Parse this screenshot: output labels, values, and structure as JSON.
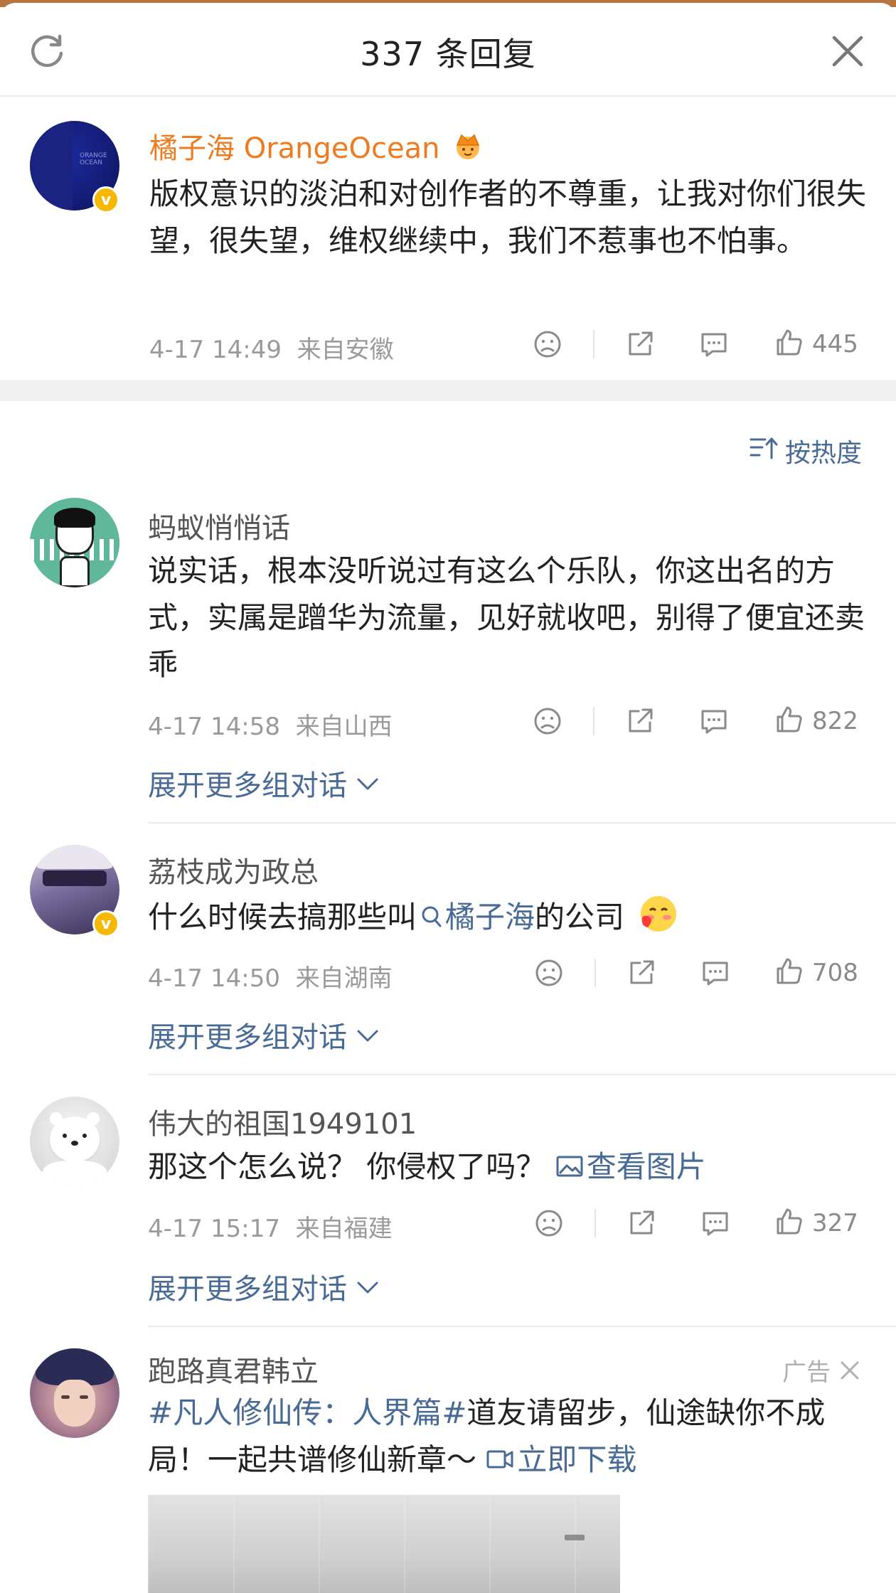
{
  "header": {
    "title": "337 条回复"
  },
  "main_comment": {
    "author": "橘子海 OrangeOcean",
    "avatar_text": "ORANGE OCEAN",
    "text": "版权意识的淡泊和对创作者的不尊重，让我对你们很失望，很失望，维权继续中，我们不惹事也不怕事。",
    "time": "4-17 14:49",
    "location": "来自安徽",
    "likes": "445"
  },
  "sort": {
    "label": "按热度"
  },
  "replies": [
    {
      "author": "蚂蚁悄悄话",
      "text": "说实话，根本没听说过有这么个乐队，你这出名的方式，实属是蹭华为流量，见好就收吧，别得了便宜还卖乖",
      "time": "4-17 14:58",
      "location": "来自山西",
      "likes": "822",
      "expand": "展开更多组对话"
    },
    {
      "author": "荔枝成为政总",
      "text_before": "什么时候去搞那些叫",
      "link": "橘子海",
      "text_after": "的公司",
      "time": "4-17 14:50",
      "location": "来自湖南",
      "likes": "708",
      "expand": "展开更多组对话"
    },
    {
      "author": "伟大的祖国1949101",
      "text": "那这个怎么说？ 你侵权了吗？ ",
      "link": "查看图片",
      "time": "4-17 15:17",
      "location": "来自福建",
      "likes": "327",
      "expand": "展开更多组对话"
    },
    {
      "author": "跑路真君韩立",
      "ad_label": "广告",
      "hashtag": "#凡人修仙传：人界篇#",
      "text": "道友请留步，仙途缺你不成局！一起共谱修仙新章～",
      "link": "立即下载"
    }
  ],
  "colors": {
    "link": "#486a96",
    "orange_name": "#f07b1f",
    "vip_badge": "#f6b800"
  }
}
